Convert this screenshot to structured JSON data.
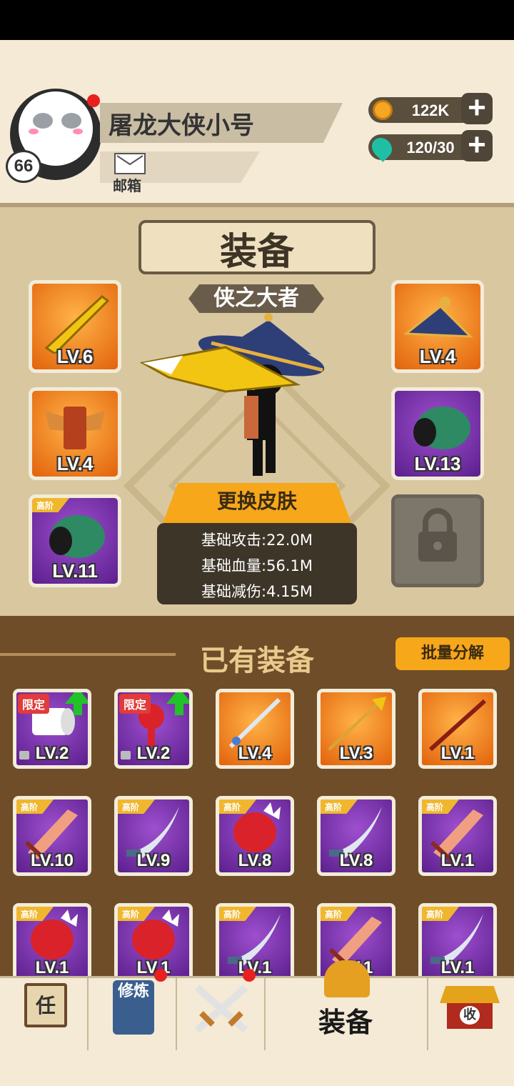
{
  "player": {
    "name": "屠龙大侠小号",
    "level": "66",
    "mail_label": "邮箱"
  },
  "resources": {
    "coins": "122K",
    "gems": "120/30"
  },
  "equip_panel": {
    "title": "装备",
    "skin_name": "侠之大者",
    "change_skin_label": "更换皮肤",
    "slots": [
      {
        "lv": "LV.6"
      },
      {
        "lv": "LV.4"
      },
      {
        "lv": "LV.4"
      },
      {
        "lv": "LV.13"
      },
      {
        "lv": "LV.11",
        "tag": "高阶"
      }
    ],
    "stats": [
      "基础攻击:22.0M",
      "基础血量:56.1M",
      "基础减伤:4.15M"
    ]
  },
  "owned": {
    "title": "已有装备",
    "batch_label": "批量分解",
    "rows": [
      [
        {
          "lv": "LV.2",
          "tag": "限定"
        },
        {
          "lv": "LV.2",
          "tag": "限定"
        },
        {
          "lv": "LV.4"
        },
        {
          "lv": "LV.3"
        },
        {
          "lv": "LV.1"
        }
      ],
      [
        {
          "lv": "LV.10",
          "tag": "高阶"
        },
        {
          "lv": "LV.9",
          "tag": "高阶"
        },
        {
          "lv": "LV.8",
          "tag": "高阶"
        },
        {
          "lv": "LV.8",
          "tag": "高阶"
        },
        {
          "lv": "LV.1",
          "tag": "高阶"
        }
      ],
      [
        {
          "lv": "LV.1",
          "tag": "高阶"
        },
        {
          "lv": "LV.1",
          "tag": "高阶"
        },
        {
          "lv": "LV.1",
          "tag": "高阶"
        },
        {
          "lv": "LV.1",
          "tag": "高阶"
        },
        {
          "lv": "LV.1",
          "tag": "高阶"
        }
      ]
    ]
  },
  "nav": {
    "task_char": "任",
    "cultivate_chars": "修炼",
    "equip_label": "装备",
    "collect_char": "收"
  },
  "colors": {
    "accent": "#f6a71a",
    "panel": "#d9c7a0",
    "inventory_bg": "#6e4d28"
  }
}
